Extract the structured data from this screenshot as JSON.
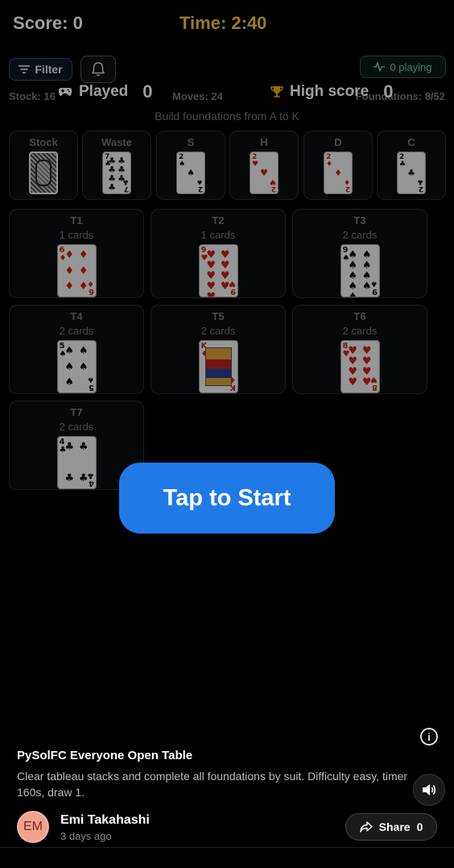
{
  "hud": {
    "score": "Score: 0",
    "time": "Time: 2:40",
    "time_color": "#f5c842"
  },
  "controls": {
    "filter_label": "Filter",
    "bell_icon": "bell-icon",
    "playing_label": "0 playing"
  },
  "stats": {
    "stock": "Stock: 16",
    "played_label": "Played",
    "played_value": "0",
    "moves": "Moves: 24",
    "high_label": "High score",
    "high_value": "0",
    "foundations": "Foundations: 8/52",
    "subtitle": "Build foundations from A to K"
  },
  "top_slots": [
    {
      "label": "Stock",
      "card": "back"
    },
    {
      "label": "Waste",
      "card": {
        "rank": "7",
        "suit": "♣",
        "color": "black"
      }
    },
    {
      "label": "S",
      "card": {
        "rank": "2",
        "suit": "♠",
        "color": "black"
      }
    },
    {
      "label": "H",
      "card": {
        "rank": "2",
        "suit": "♥",
        "color": "red"
      }
    },
    {
      "label": "D",
      "card": {
        "rank": "2",
        "suit": "♦",
        "color": "red"
      }
    },
    {
      "label": "C",
      "card": {
        "rank": "2",
        "suit": "♣",
        "color": "black"
      }
    }
  ],
  "tableau": [
    {
      "label": "T1",
      "count": "1 cards",
      "card": {
        "rank": "6",
        "suit": "♦",
        "color": "red"
      }
    },
    {
      "label": "T2",
      "count": "1 cards",
      "card": {
        "rank": "9",
        "suit": "♥",
        "color": "red"
      }
    },
    {
      "label": "T3",
      "count": "2 cards",
      "card": {
        "rank": "9",
        "suit": "♠",
        "color": "black"
      }
    },
    {
      "label": "T4",
      "count": "2 cards",
      "card": {
        "rank": "5",
        "suit": "♠",
        "color": "black"
      }
    },
    {
      "label": "T5",
      "count": "2 cards",
      "card": {
        "rank": "K",
        "suit": "♦",
        "color": "red"
      }
    },
    {
      "label": "T6",
      "count": "2 cards",
      "card": {
        "rank": "8",
        "suit": "♥",
        "color": "red"
      }
    },
    {
      "label": "T7",
      "count": "2 cards",
      "card": {
        "rank": "4",
        "suit": "♣",
        "color": "black"
      }
    }
  ],
  "start_label": "Tap to Start",
  "game": {
    "title": "PySolFC Everyone Open Table",
    "description": "Clear tableau stacks and complete all foundations by suit. Difficulty easy, timer 160s, draw 1."
  },
  "author": {
    "initials": "EM",
    "name": "Emi Takahashi",
    "posted": "3 days ago"
  },
  "share": {
    "label": "Share",
    "count": "0"
  },
  "colors": {
    "accent": "#1f7ae8",
    "playing": "#5fd0a7"
  }
}
